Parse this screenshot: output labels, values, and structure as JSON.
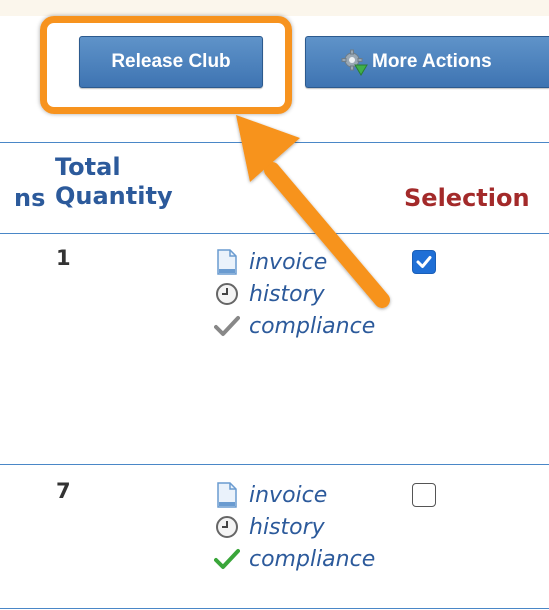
{
  "toolbar": {
    "release_label": "Release Club",
    "more_actions_label": "More Actions"
  },
  "table": {
    "headers": {
      "partial": "ns",
      "total_line1": "Total",
      "total_line2": "Quantity",
      "selection": "Selection"
    },
    "rows": [
      {
        "quantity": "1",
        "invoice": "invoice",
        "history": "history",
        "compliance": "compliance",
        "selected": true,
        "compliance_color": "#888888"
      },
      {
        "quantity": "7",
        "invoice": "invoice",
        "history": "history",
        "compliance": "compliance",
        "selected": false,
        "compliance_color": "#3aa63a"
      }
    ]
  },
  "colors": {
    "accent": "#f7931e",
    "button": "#3e74b2",
    "link": "#2c5a9b",
    "selection_header": "#a32a2a"
  }
}
